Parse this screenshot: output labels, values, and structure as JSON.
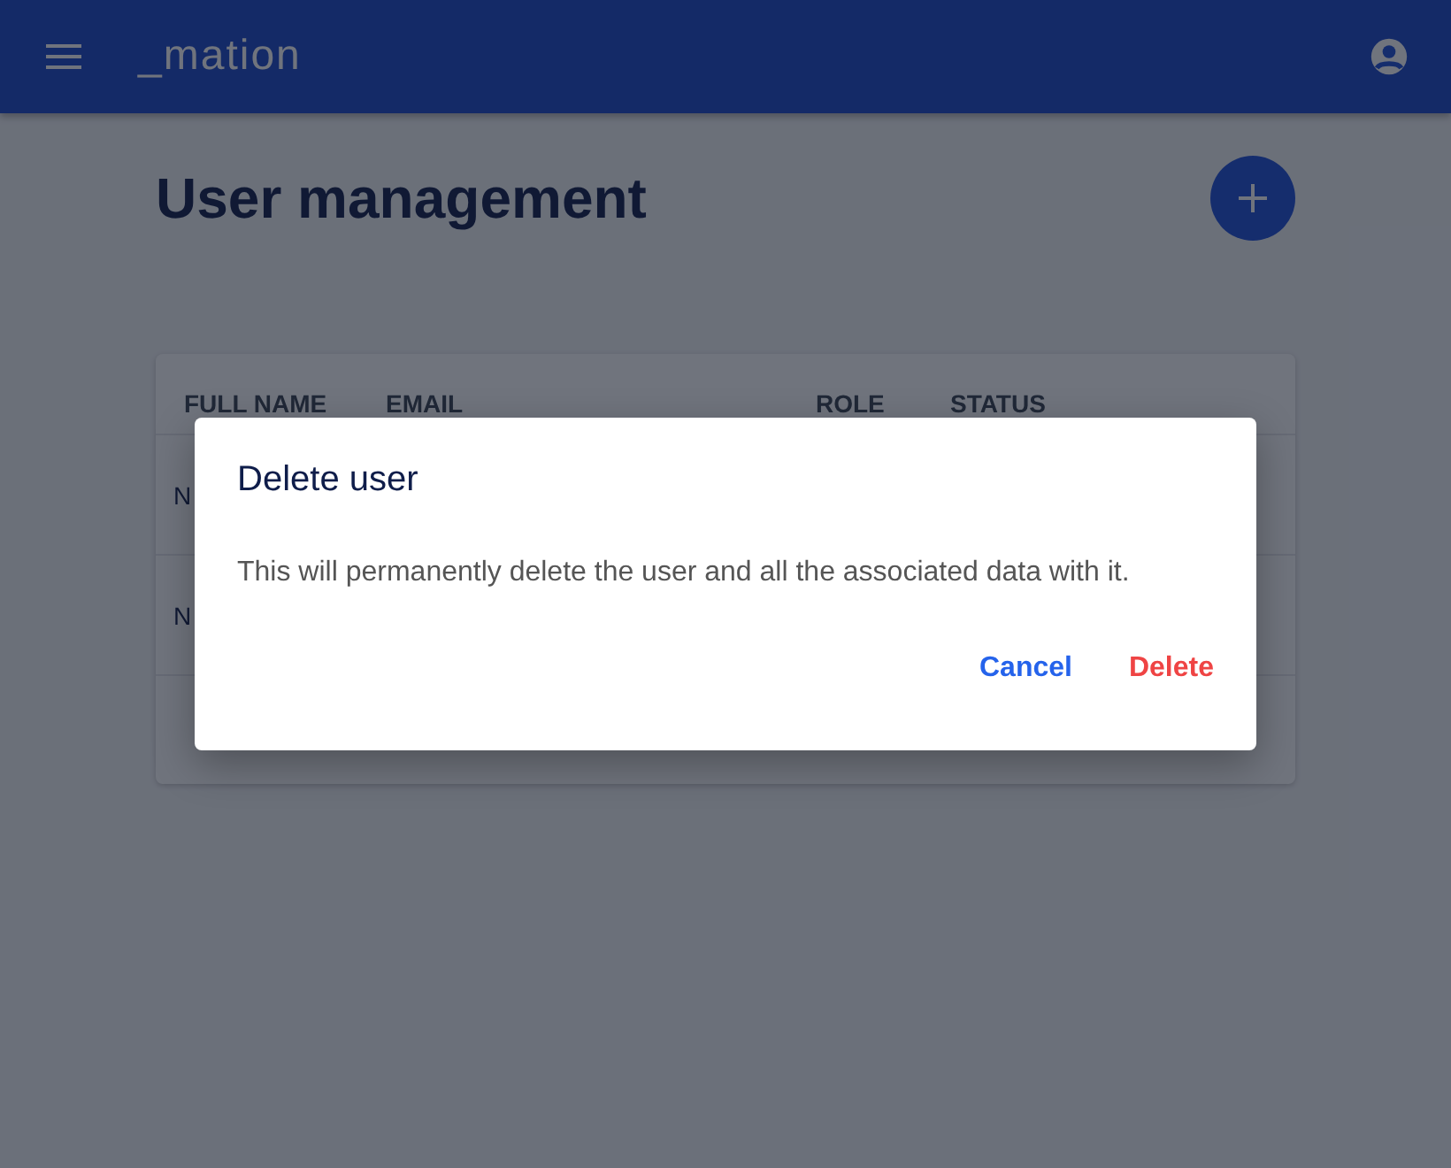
{
  "app_bar": {
    "logo": "_mation"
  },
  "page": {
    "title": "User management"
  },
  "table": {
    "columns": [
      "FULL NAME",
      "EMAIL",
      "ROLE",
      "STATUS"
    ],
    "rows": [
      {
        "column_1": "N"
      },
      {
        "column_1": "N"
      }
    ]
  },
  "dialog": {
    "title": "Delete user",
    "message": "This will permanently delete the user and all the associated data with it.",
    "buttons": [
      {
        "label": "Cancel",
        "kind": "neutral"
      },
      {
        "label": "Delete",
        "kind": "danger"
      }
    ]
  }
}
